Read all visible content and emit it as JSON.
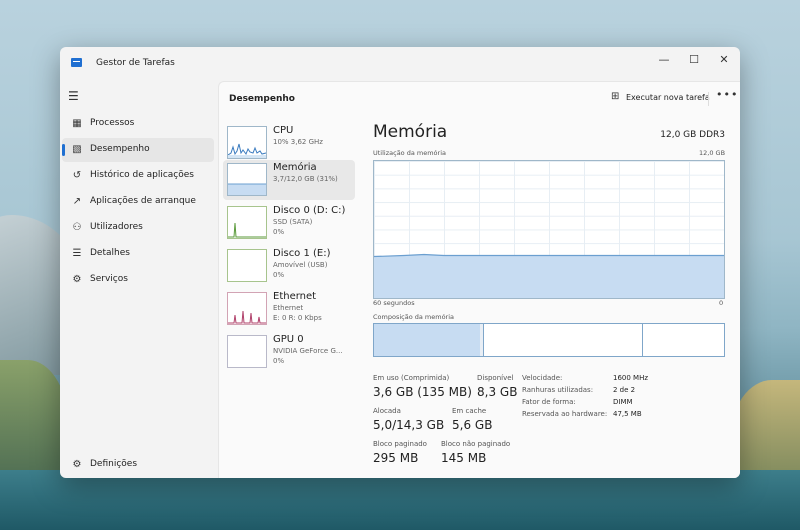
{
  "window": {
    "title": "Gestor de Tarefas"
  },
  "titlebar_buttons": {
    "minimize": "—",
    "maximize": "☐",
    "close": "✕"
  },
  "sidebar": {
    "items": [
      {
        "label": "Processos",
        "icon": "processes-icon"
      },
      {
        "label": "Desempenho",
        "icon": "performance-icon"
      },
      {
        "label": "Histórico de aplicações",
        "icon": "history-icon"
      },
      {
        "label": "Aplicações de arranque",
        "icon": "startup-icon"
      },
      {
        "label": "Utilizadores",
        "icon": "users-icon"
      },
      {
        "label": "Detalhes",
        "icon": "details-icon"
      },
      {
        "label": "Serviços",
        "icon": "services-icon"
      }
    ],
    "settings_label": "Definições"
  },
  "header": {
    "title": "Desempenho",
    "new_task_label": "Executar nova tarefa",
    "more": "•••"
  },
  "resources": [
    {
      "name": "CPU",
      "sub1": "10%  3,62 GHz",
      "sub2": ""
    },
    {
      "name": "Memória",
      "sub1": "3,7/12,0 GB (31%)",
      "sub2": ""
    },
    {
      "name": "Disco 0 (D: C:)",
      "sub1": "SSD (SATA)",
      "sub2": "0%"
    },
    {
      "name": "Disco 1 (E:)",
      "sub1": "Amovível (USB)",
      "sub2": "0%"
    },
    {
      "name": "Ethernet",
      "sub1": "Ethernet",
      "sub2": "E: 0 R: 0 Kbps"
    },
    {
      "name": "GPU 0",
      "sub1": "NVIDIA GeForce G...",
      "sub2": "0%"
    }
  ],
  "detail": {
    "title": "Memória",
    "spec": "12,0 GB DDR3",
    "usage_label": "Utilização da memória",
    "usage_max": "12,0 GB",
    "time_label": "60 segundos",
    "time_end": "0",
    "usage_fraction": 0.31,
    "composition_label": "Composição da memória",
    "stats": [
      {
        "label": "Em uso (Comprimida)",
        "value": "3,6 GB (135 MB)"
      },
      {
        "label": "Disponível",
        "value": "8,3 GB"
      },
      {
        "label": "Alocada",
        "value": "5,0/14,3 GB"
      },
      {
        "label": "Em cache",
        "value": "5,6 GB"
      },
      {
        "label": "Bloco paginado",
        "value": "295 MB"
      },
      {
        "label": "Bloco não paginado",
        "value": "145 MB"
      }
    ],
    "props": [
      {
        "k": "Velocidade:",
        "v": "1600 MHz"
      },
      {
        "k": "Ranhuras utilizadas:",
        "v": "2 de 2"
      },
      {
        "k": "Fator de forma:",
        "v": "DIMM"
      },
      {
        "k": "Reservada ao hardware:",
        "v": "47,5 MB"
      }
    ]
  },
  "colors": {
    "accent": "#1f6fd1",
    "memory_fill": "#c7dcf2",
    "memory_line": "#6b9fd0"
  }
}
